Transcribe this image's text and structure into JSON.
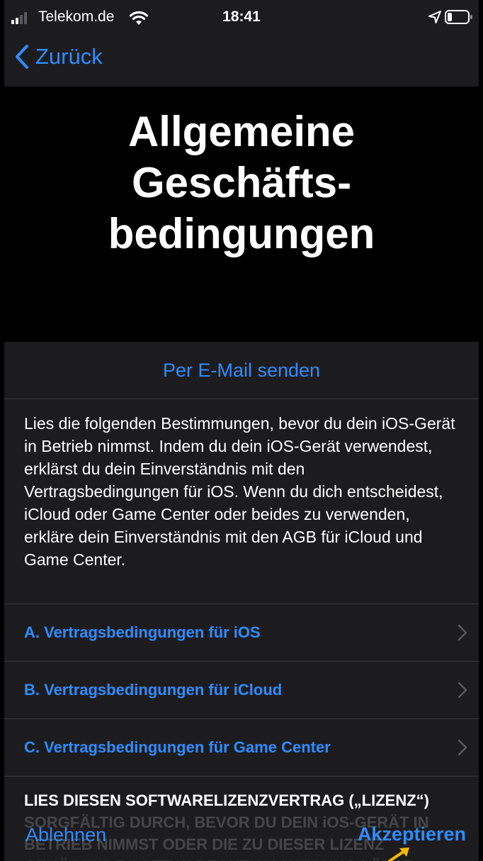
{
  "status_bar": {
    "carrier": "Telekom.de",
    "time": "18:41",
    "icons": [
      "signal-icon",
      "wifi-icon",
      "location-icon",
      "battery-icon"
    ]
  },
  "nav": {
    "back_label": "Zurück",
    "back_icon": "chevron-left-icon"
  },
  "header": {
    "title": "Allgemeine\nGeschäfts-\nbedingungen"
  },
  "content": {
    "email_label": "Per E-Mail senden",
    "intro": "Lies die folgenden Bestimmungen, bevor du dein iOS-Gerät in Betrieb nimmst. Indem du dein iOS-Gerät verwendest, erklärst du dein Einverständnis mit den Vertragsbedingungen für iOS. Wenn du dich entscheidest, iCloud oder Game Center oder beides zu verwenden, erkläre dein Einverständnis mit den AGB für iCloud und Game Center.",
    "terms": [
      {
        "label": "A. Vertragsbedingungen für iOS"
      },
      {
        "label": "B. Vertragsbedingungen für iCloud"
      },
      {
        "label": "C. Vertragsbedingungen für Game Center"
      }
    ],
    "license_text": "LIES DIESEN SOFTWARELIZENZVERTRAG („LIZENZ“) SORGFÄLTIG DURCH, BEVOR DU DEIN iOS-GERÄT IN BETRIEB NIMMST ODER DIE ZU DIESER LIZENZ GEHÖRENDE SOFTWAREAKTUALISIERUNG LÄDST. INDEM DU DEIN iOS-GERÄT VERWENDEST ODER"
  },
  "toolbar": {
    "decline_label": "Ablehnen",
    "accept_label": "Akzeptieren"
  },
  "colors": {
    "accent": "#2f8cff",
    "background": "#1c1c1e",
    "header_background": "#000000",
    "separator": "#3a3a3c",
    "cursor": "#f5b800"
  }
}
